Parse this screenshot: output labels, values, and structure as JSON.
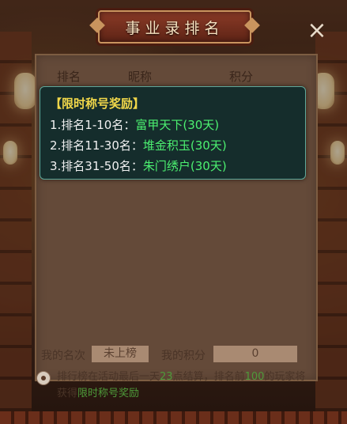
{
  "window": {
    "title": "事业录排名",
    "close_symbol": "×"
  },
  "table": {
    "headers": [
      "排名",
      "昵称",
      "积分"
    ]
  },
  "tooltip": {
    "title": "【限时称号奖励】",
    "rewards": [
      {
        "label": "1.排名1-10名：",
        "value": "富甲天下(30天)"
      },
      {
        "label": "2.排名11-30名：",
        "value": "堆金积玉(30天)"
      },
      {
        "label": "3.排名31-50名：",
        "value": "朱门绣户(30天)"
      }
    ]
  },
  "mine": {
    "rank_label": "我的名次",
    "rank_value": "未上榜",
    "score_label": "我的积分",
    "score_value": "0"
  },
  "note": {
    "p1": "排行榜在活动最后一天",
    "p2": "23",
    "p3": "点结算，排名前",
    "p4": "100",
    "p5": "的玩家将获得",
    "p6": "限时称号奖励"
  },
  "colors": {
    "reward_green": "#4cf070",
    "tooltip_title": "#f2d84a",
    "tooltip_bg": "#102c2c"
  }
}
